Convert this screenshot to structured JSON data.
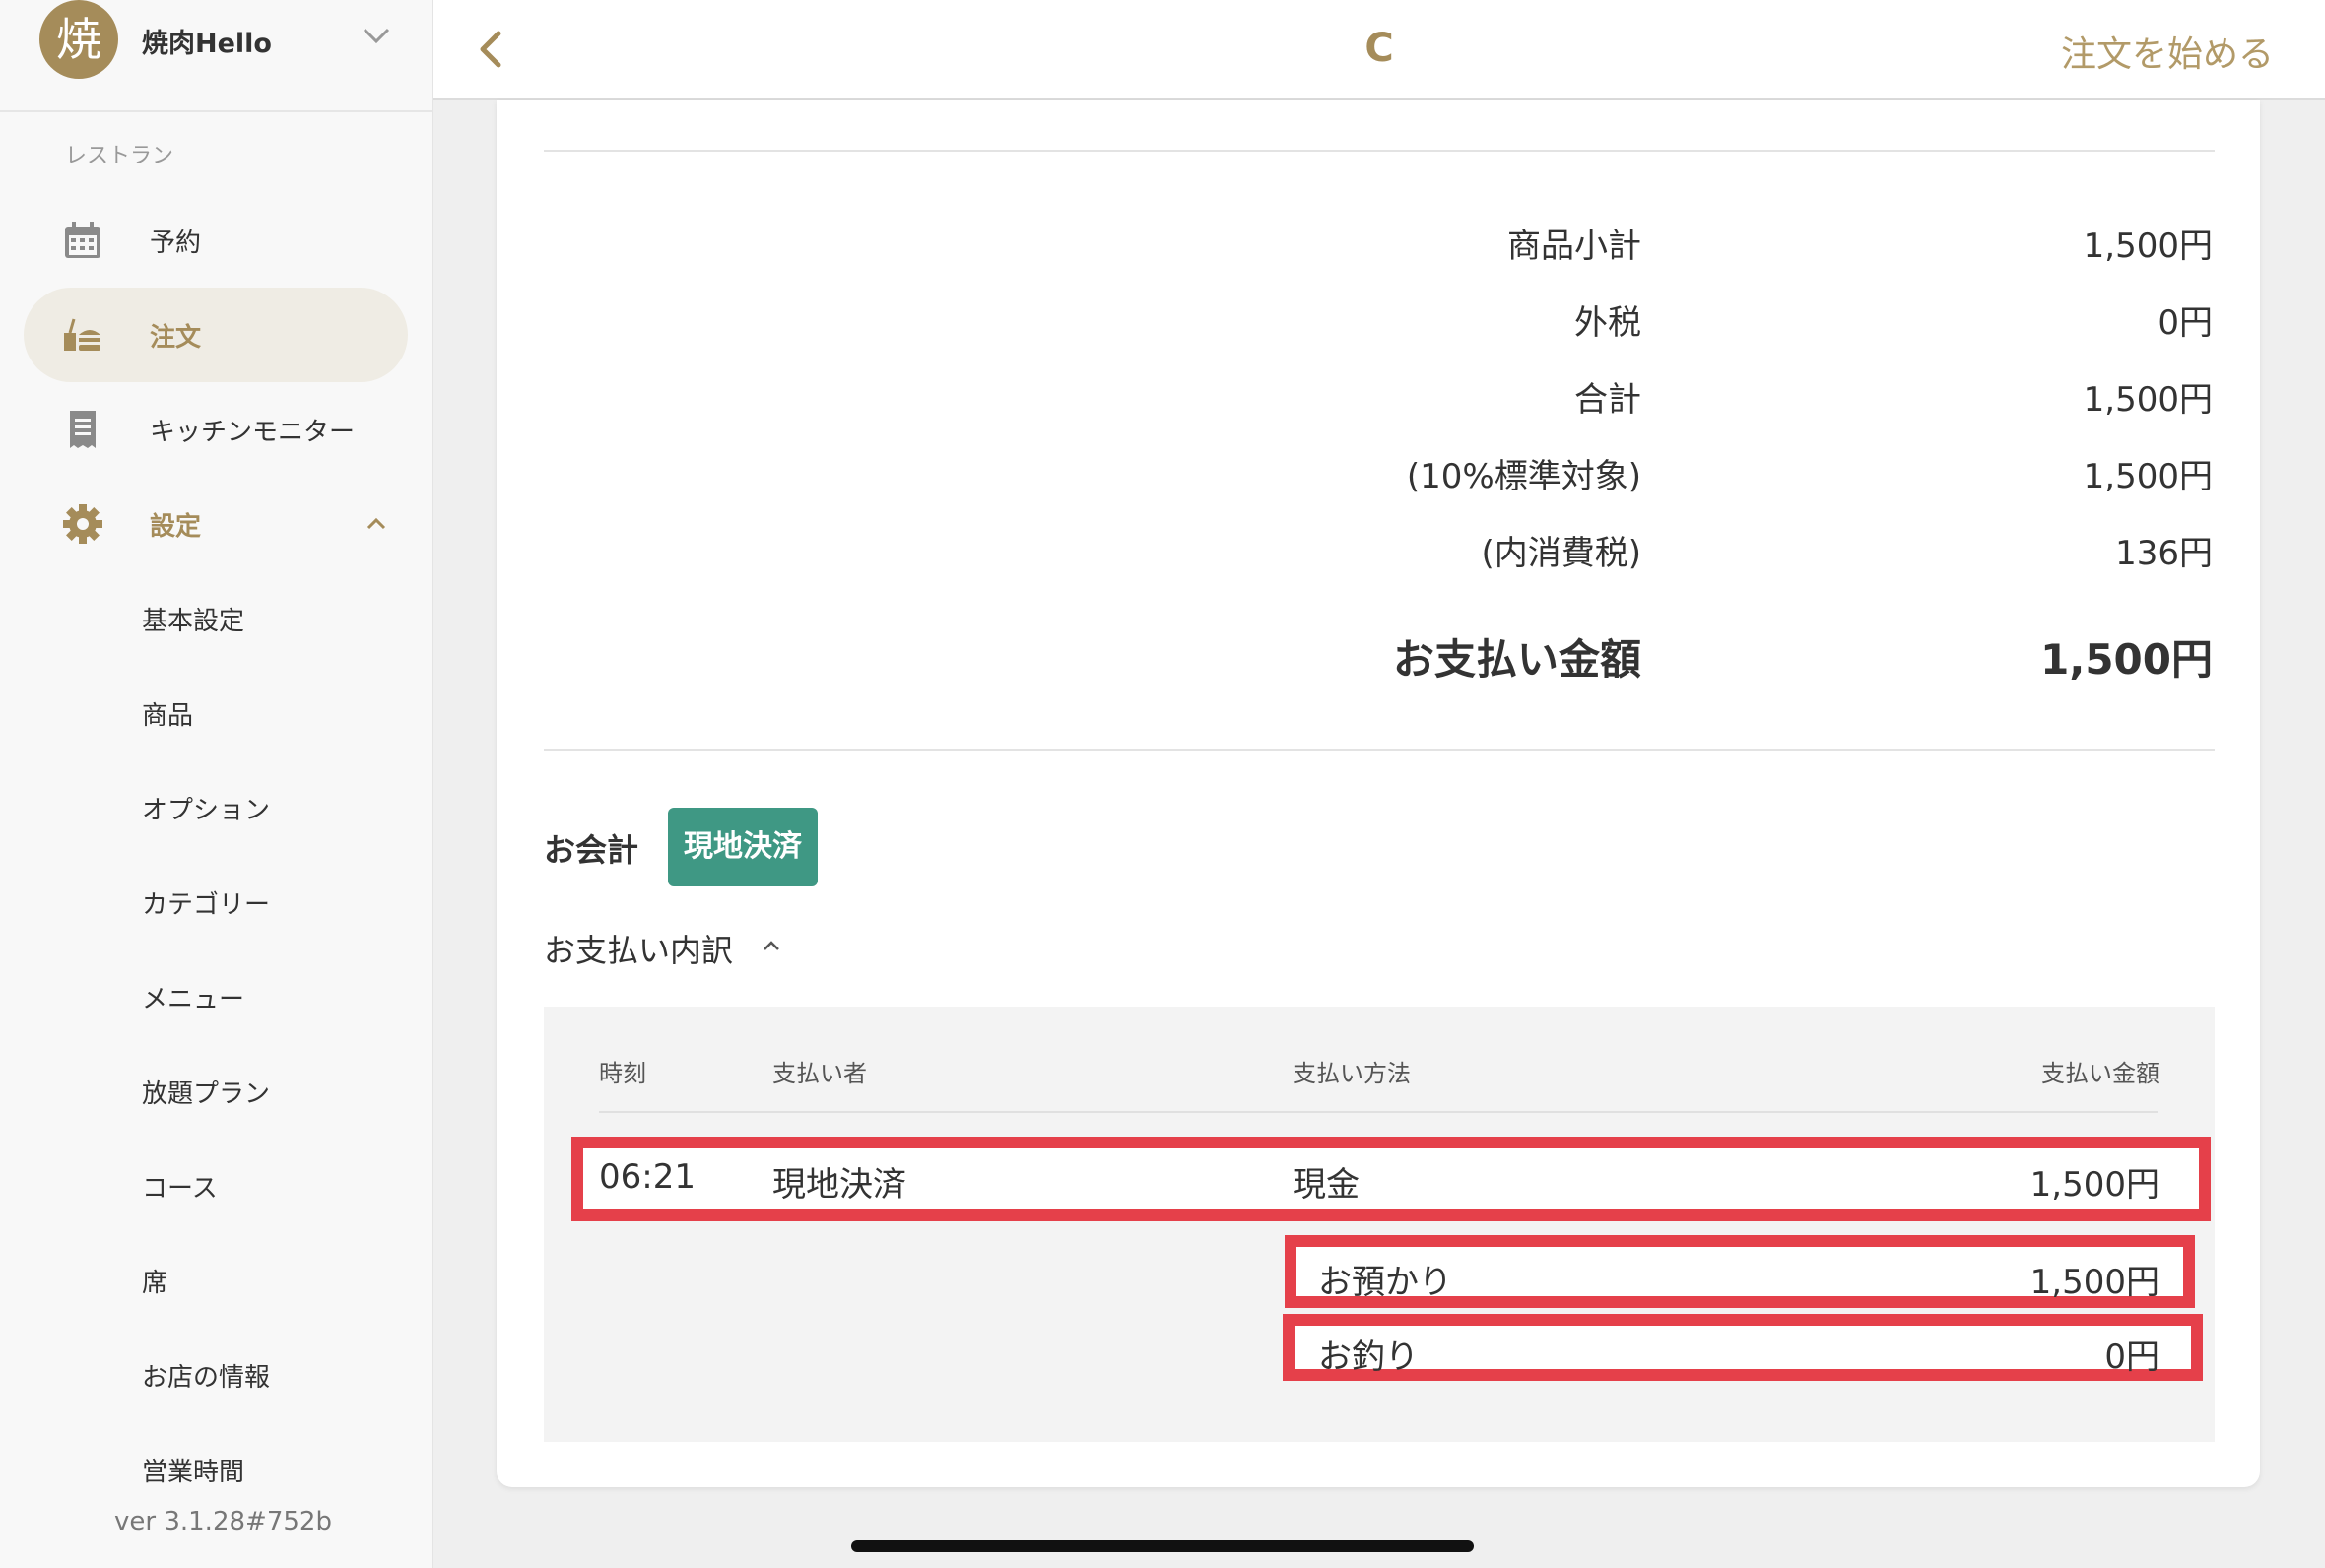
{
  "sidebar": {
    "avatar_char": "焼",
    "restaurant_name": "焼肉Hello",
    "section_label": "レストラン",
    "nav": [
      {
        "label": "予約",
        "icon": "calendar-icon"
      },
      {
        "label": "注文",
        "icon": "order-tray-icon"
      },
      {
        "label": "キッチンモニター",
        "icon": "receipt-icon"
      },
      {
        "label": "設定",
        "icon": "gear-icon"
      }
    ],
    "sub_items": [
      "基本設定",
      "商品",
      "オプション",
      "カテゴリー",
      "メニュー",
      "放題プラン",
      "コース",
      "席",
      "お店の情報",
      "営業時間"
    ],
    "version": "ver 3.1.28#752b"
  },
  "topbar": {
    "title": "C",
    "start_order": "注文を始める"
  },
  "summary": [
    {
      "label": "商品小計",
      "value": "1,500円"
    },
    {
      "label": "外税",
      "value": "0円"
    },
    {
      "label": "合計",
      "value": "1,500円"
    },
    {
      "label": "(10%標準対象)",
      "value": "1,500円"
    },
    {
      "label": "(内消費税)",
      "value": "136円"
    }
  ],
  "total": {
    "label": "お支払い金額",
    "value": "1,500円"
  },
  "accounting": {
    "label": "お会計",
    "badge": "現地決済",
    "breakdown_label": "お支払い内訳"
  },
  "payments_table": {
    "headers": [
      "時刻",
      "支払い者",
      "支払い方法",
      "支払い金額"
    ],
    "row": {
      "time": "06:21",
      "payer": "現地決済",
      "method": "現金",
      "amount": "1,500円"
    },
    "deposit": {
      "label": "お預かり",
      "value": "1,500円"
    },
    "change": {
      "label": "お釣り",
      "value": "0円"
    }
  },
  "colors": {
    "accent": "#a58c5a",
    "badge": "#3f9884",
    "highlight": "#e5404a"
  }
}
